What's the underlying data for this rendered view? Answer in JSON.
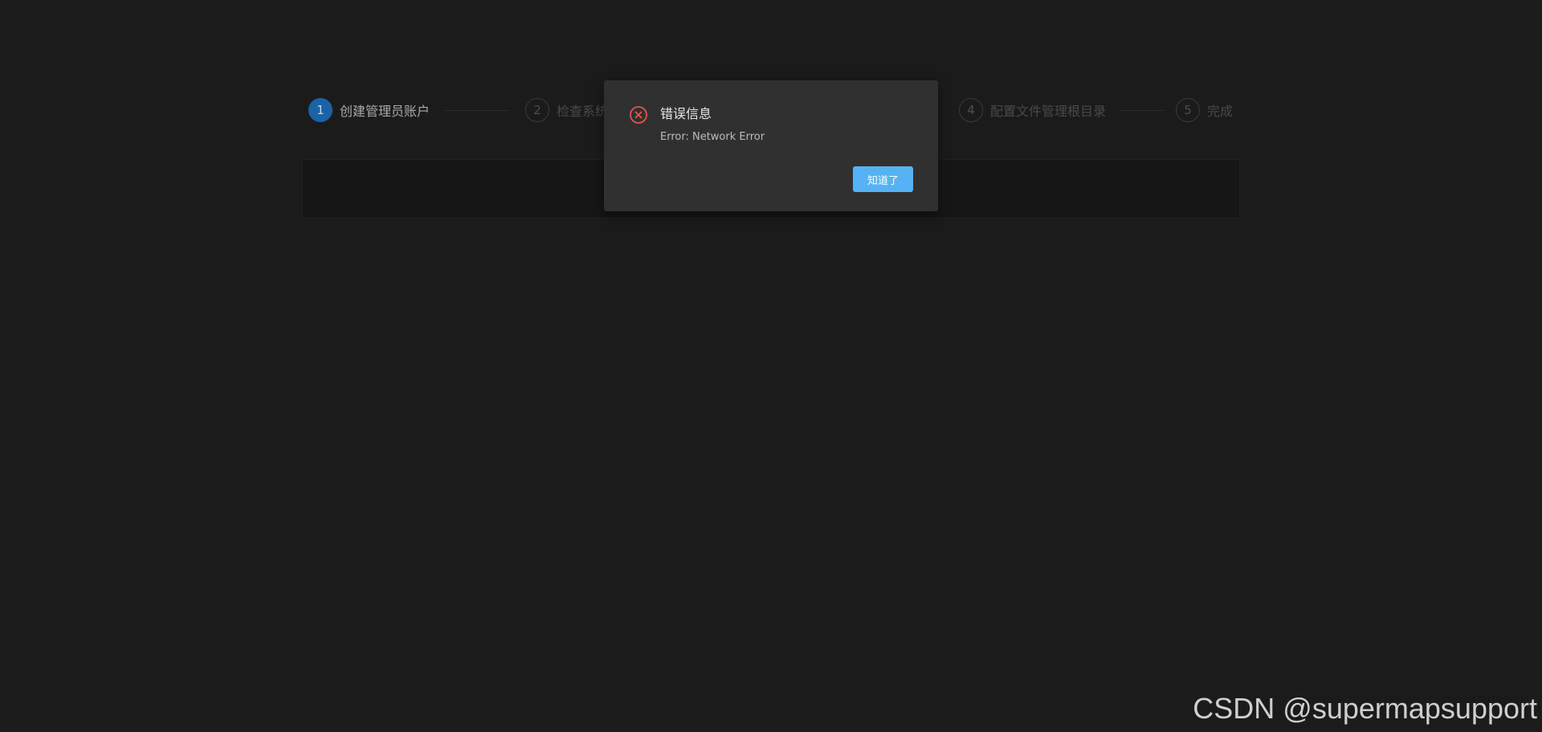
{
  "steps": [
    {
      "number": "1",
      "label": "创建管理员账户",
      "active": true
    },
    {
      "number": "2",
      "label": "检查系统",
      "active": false
    },
    {
      "number": "4",
      "label": "配置文件管理根目录",
      "active": false
    },
    {
      "number": "5",
      "label": "完成",
      "active": false
    }
  ],
  "dialog": {
    "icon": "close-circle-icon",
    "title": "错误信息",
    "message": "Error: Network Error",
    "button_label": "知道了"
  },
  "watermark": "CSDN @supermapsupport",
  "colors": {
    "background": "#1b1b1b",
    "active_step": "#1a63a7",
    "dialog_bg": "#303030",
    "primary_button": "#56b2f5",
    "error_icon": "#e0584a"
  }
}
